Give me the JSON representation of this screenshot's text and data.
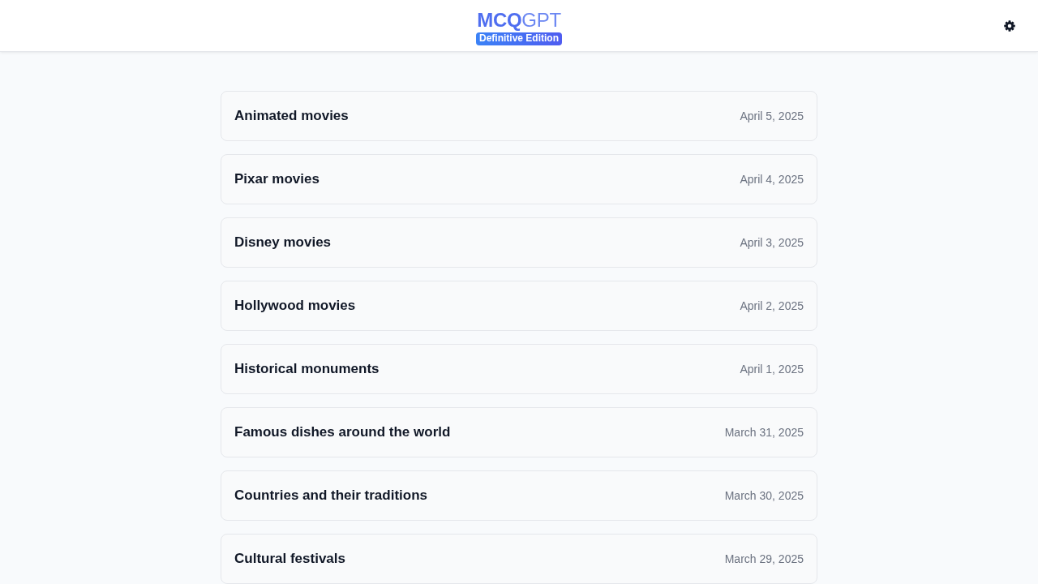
{
  "header": {
    "logo": "**MCQ**GPT",
    "badge": "Definitive Edition"
  },
  "quizzes": [
    {
      "title": "Animated movies",
      "date": "April 5, 2025"
    },
    {
      "title": "Pixar movies",
      "date": "April 4, 2025"
    },
    {
      "title": "Disney movies",
      "date": "April 3, 2025"
    },
    {
      "title": "Hollywood movies",
      "date": "April 2, 2025"
    },
    {
      "title": "Historical monuments",
      "date": "April 1, 2025"
    },
    {
      "title": "Famous dishes around the world",
      "date": "March 31, 2025"
    },
    {
      "title": "Countries and their traditions",
      "date": "March 30, 2025"
    },
    {
      "title": "Cultural festivals",
      "date": "March 29, 2025"
    }
  ]
}
